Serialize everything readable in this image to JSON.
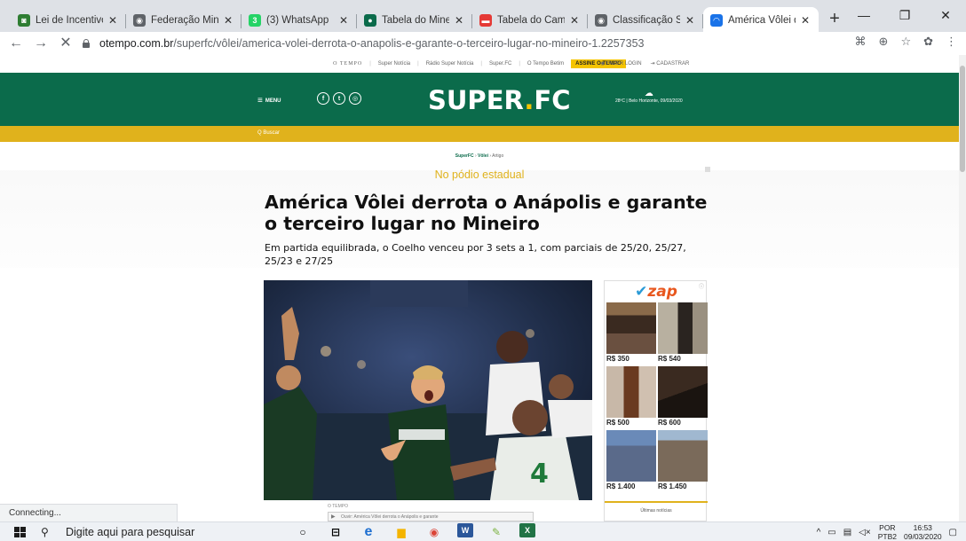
{
  "browser": {
    "tabs": [
      {
        "title": "Lei de Incentivo ao",
        "favicon_color": "#2e7d32",
        "favicon_glyph": "◙"
      },
      {
        "title": "Federação Mineira",
        "favicon_color": "#5f6368",
        "favicon_glyph": "◉"
      },
      {
        "title": "(3) WhatsApp",
        "favicon_color": "#25d366",
        "favicon_glyph": "3"
      },
      {
        "title": "Tabela do Mineiro",
        "favicon_color": "#0b6b4b",
        "favicon_glyph": "●"
      },
      {
        "title": "Tabela do Campeo",
        "favicon_color": "#e53935",
        "favicon_glyph": "▬"
      },
      {
        "title": "Classificação Supe",
        "favicon_color": "#5f6368",
        "favicon_glyph": "◉"
      },
      {
        "title": "América Vôlei der",
        "favicon_color": "#1a73e8",
        "favicon_glyph": "◠",
        "active": true
      }
    ],
    "new_tab": "+",
    "window_controls": {
      "minimize": "—",
      "restore": "❐",
      "close": "✕"
    },
    "nav": {
      "back": "←",
      "forward": "→",
      "stop": "✕"
    },
    "url_host": "otempo.com.br",
    "url_path": "/superfc/vôlei/america-volei-derrota-o-anapolis-e-garante-o-terceiro-lugar-no-mineiro-1.2257353",
    "toolbar_icons": [
      "translate-icon",
      "zoom-icon",
      "bookmark-star-icon",
      "extension-icon",
      "menu-icon"
    ],
    "status_text": "Connecting..."
  },
  "site": {
    "topbar": {
      "items": [
        "O TEMPO",
        "Super Notícia",
        "Rádio Super Notícia",
        "Super.FC",
        "O Tempo Betim"
      ],
      "subscribe": "ASSINE O TEMPO",
      "login": "FAZER LOGIN",
      "register": "CADASTRAR"
    },
    "menu_label": "MENU",
    "social": [
      "f",
      "t",
      "◎"
    ],
    "logo_main": "SUPER",
    "logo_dot": ".",
    "logo_tail": "FC",
    "weather": "28ºC | Belo Horizonte, 09/03/2020",
    "search_label": "Q  Buscar",
    "brand_green": "#0b6b4b",
    "brand_yellow": "#e0b21c"
  },
  "article": {
    "breadcrumb": [
      "SuperFC",
      "Vôlei",
      "Artigo"
    ],
    "kicker": "No pódio estadual",
    "title": "América Vôlei derrota o Anápolis e garante o terceiro lugar no Mineiro",
    "subtitle": "Em partida equilibrada, o Coelho venceu por 3 sets a 1, com parciais de 25/20, 25/27, 25/23 e 27/25",
    "photo_credit": "O TEMPO",
    "video_player_text": "Ouvir: América Vôlei derrota o Anápolis e garante"
  },
  "ad": {
    "brand": "zap",
    "prices": [
      "R$ 350",
      "R$ 540",
      "R$ 500",
      "R$ 600",
      "R$ 1.400",
      "R$ 1.450"
    ],
    "footer": "Últimas notícias"
  },
  "taskbar": {
    "search_placeholder": "Digite aqui para pesquisar",
    "apps": [
      "cortana-icon",
      "task-view-icon",
      "edge-icon",
      "file-explorer-icon",
      "chrome-icon",
      "word-icon",
      "paint-icon",
      "excel-icon"
    ],
    "lang_top": "POR",
    "lang_bottom": "PTB2",
    "time": "16:53",
    "date": "09/03/2020"
  }
}
